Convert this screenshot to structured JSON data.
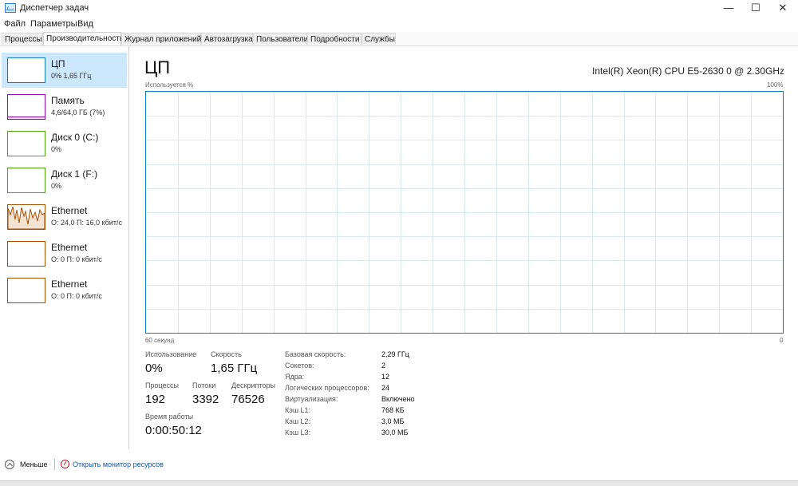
{
  "window": {
    "title": "Диспетчер задач"
  },
  "menu": [
    "Файл",
    "Параметры",
    "Вид"
  ],
  "tabs": [
    "Процессы",
    "Производительность",
    "Журнал приложений",
    "Автозагрузка",
    "Пользователи",
    "Подробности",
    "Службы"
  ],
  "active_tab": "Производительность",
  "sidebar": {
    "items": [
      {
        "title": "ЦП",
        "sub": "0% 1,65 ГГц",
        "color": "#117dbb",
        "selected": true
      },
      {
        "title": "Память",
        "sub": "4,6/64,0 ГБ (7%)",
        "color": "#8b12ae",
        "selected": false
      },
      {
        "title": "Диск 0 (C:)",
        "sub": "0%",
        "color": "#4da60c",
        "selected": false
      },
      {
        "title": "Диск 1 (F:)",
        "sub": "0%",
        "color": "#4da60c",
        "selected": false
      },
      {
        "title": "Ethernet",
        "sub": "О: 24,0 П: 16,0 кбит/с",
        "color": "#a74f01",
        "selected": false
      },
      {
        "title": "Ethernet",
        "sub": "О: 0 П: 0 кбит/с",
        "color": "#a74f01",
        "selected": false
      },
      {
        "title": "Ethernet",
        "sub": "О: 0 П: 0 кбит/с",
        "color": "#a74f01",
        "selected": false
      }
    ]
  },
  "main": {
    "title": "ЦП",
    "model": "Intel(R) Xeon(R) CPU E5-2630 0 @ 2.30GHz",
    "graph_top_left": "Используется %",
    "graph_top_right": "100%",
    "graph_bottom_left": "60 секунд",
    "graph_bottom_right": "0",
    "graph_color": "#117dbb",
    "grid_color": "#d9eaf7"
  },
  "stats": {
    "usage_label": "Использование",
    "usage_value": "0%",
    "speed_label": "Скорость",
    "speed_value": "1,65 ГГц",
    "processes_label": "Процессы",
    "processes_value": "192",
    "threads_label": "Потоки",
    "threads_value": "3392",
    "handles_label": "Дескрипторы",
    "handles_value": "76526",
    "uptime_label": "Время работы",
    "uptime_value": "0:00:50:12"
  },
  "specs": [
    {
      "label": "Базовая скорость:",
      "value": "2,29 ГГц"
    },
    {
      "label": "Сокетов:",
      "value": "2"
    },
    {
      "label": "Ядра:",
      "value": "12"
    },
    {
      "label": "Логических процессоров:",
      "value": "24"
    },
    {
      "label": "Виртуализация:",
      "value": "Включено"
    },
    {
      "label": "Кэш L1:",
      "value": "768 КБ"
    },
    {
      "label": "Кэш L2:",
      "value": "3,0 МБ"
    },
    {
      "label": "Кэш L3:",
      "value": "30,0 МБ"
    }
  ],
  "footer": {
    "less": "Меньше",
    "monitor_link": "Открыть монитор ресурсов"
  }
}
